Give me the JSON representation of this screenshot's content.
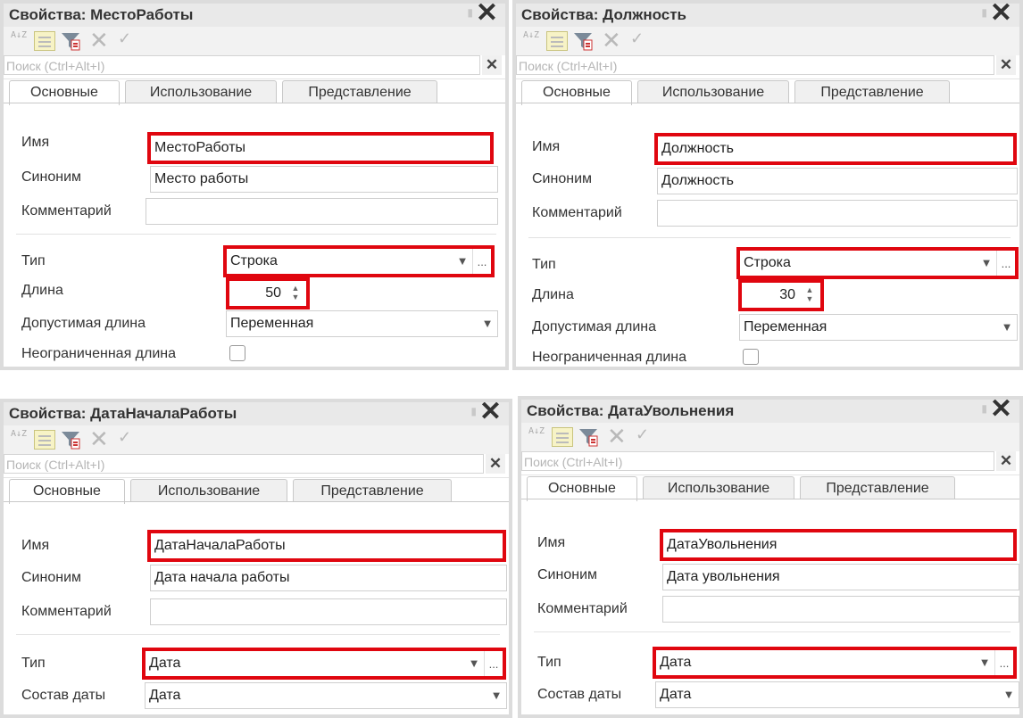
{
  "panels": [
    {
      "title": "Свойства: МестоРаботы",
      "name_value": "МестоРаботы",
      "synonym_value": "Место работы",
      "comment_value": "",
      "type_value": "Строка",
      "length_value": "50",
      "allowed_length_value": "Переменная"
    },
    {
      "title": "Свойства: Должность",
      "name_value": "Должность",
      "synonym_value": "Должность",
      "comment_value": "",
      "type_value": "Строка",
      "length_value": "30",
      "allowed_length_value": "Переменная"
    },
    {
      "title": "Свойства: ДатаНачалаРаботы",
      "name_value": "ДатаНачалаРаботы",
      "synonym_value": "Дата начала работы",
      "comment_value": "",
      "type_value": "Дата",
      "date_composition_value": "Дата"
    },
    {
      "title": "Свойства: ДатаУвольнения",
      "name_value": "ДатаУвольнения",
      "synonym_value": "Дата увольнения",
      "comment_value": "",
      "type_value": "Дата",
      "date_composition_value": "Дата"
    }
  ],
  "common": {
    "search_placeholder": "Поиск (Ctrl+Alt+I)",
    "tab_main": "Основные",
    "tab_usage": "Использование",
    "tab_view": "Представление",
    "label_name": "Имя",
    "label_synonym": "Синоним",
    "label_comment": "Комментарий",
    "label_type": "Тип",
    "label_length": "Длина",
    "label_allowed_length": "Допустимая длина",
    "label_unlimited_length": "Неограниченная длина",
    "label_date_composition": "Состав даты",
    "sort_glyph": "A↓Z",
    "delete_glyph": "✕",
    "check_glyph": "✓",
    "close_glyph": "✕",
    "pin_glyph": "▮",
    "clear_glyph": "✕",
    "dropdown_glyph": "▼",
    "dots_glyph": "...",
    "spin_up_glyph": "▲",
    "spin_down_glyph": "▼"
  },
  "colors": {
    "highlight": "#e0060f",
    "panel_border": "#dcdcdc",
    "titlebar": "#e9e9e9"
  }
}
